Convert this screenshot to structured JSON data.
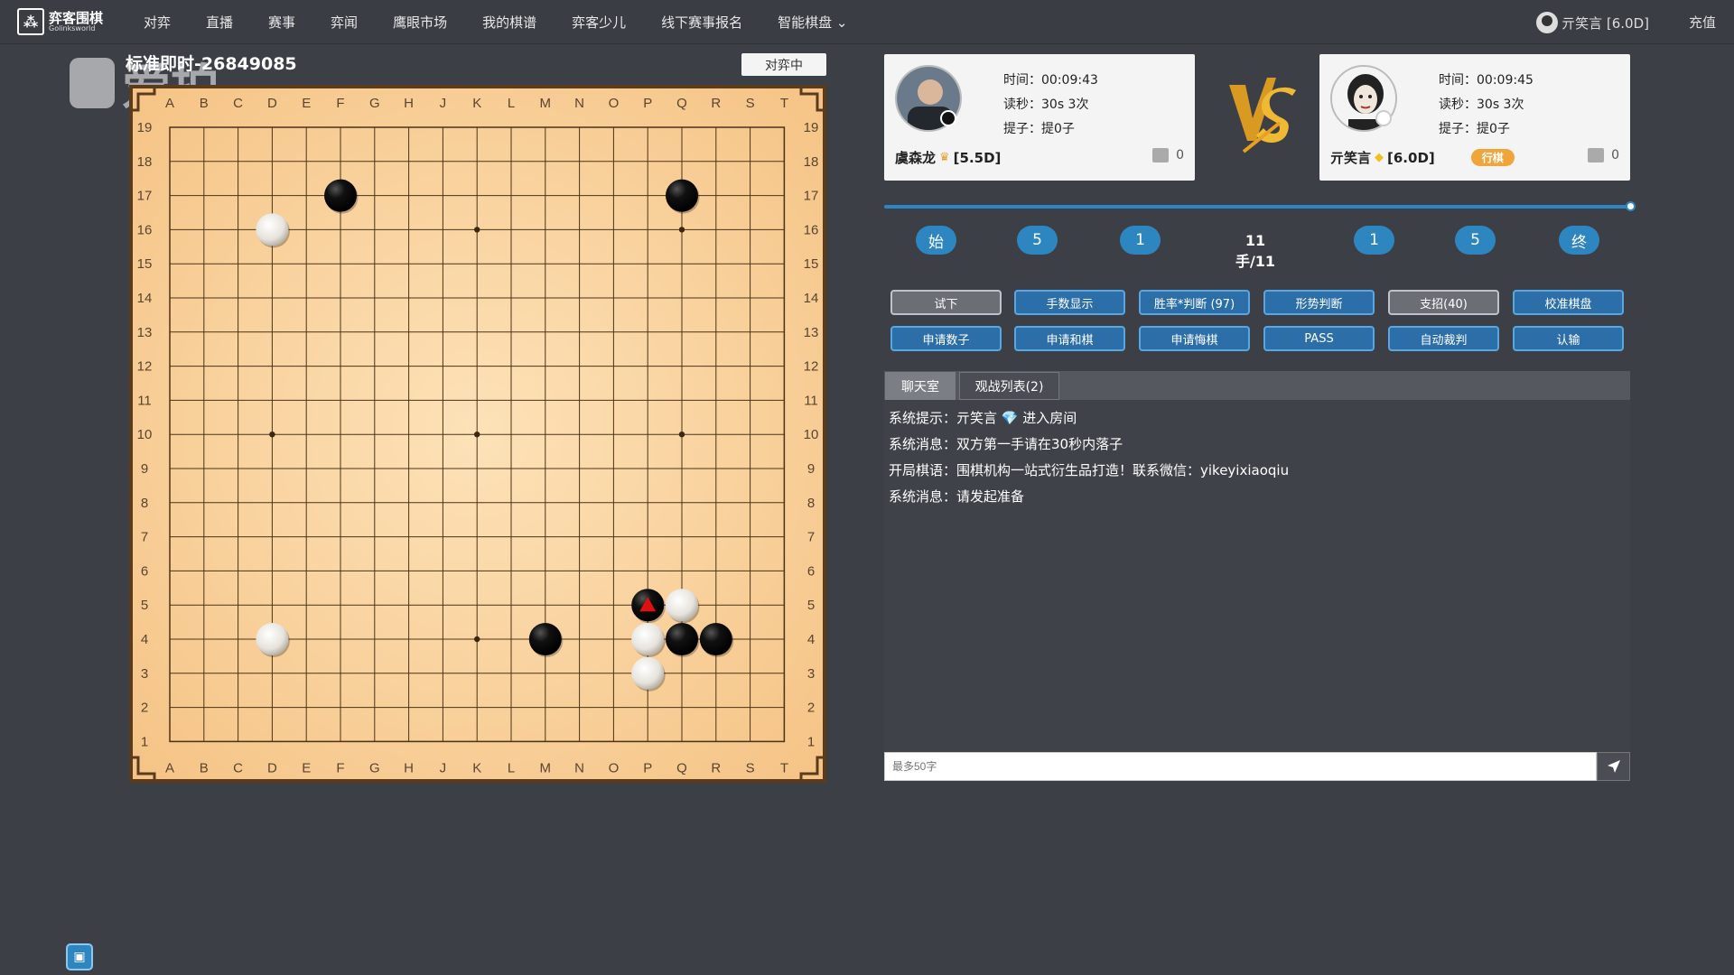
{
  "logo": {
    "cn": "弈客围棋",
    "en": "Golinksworld"
  },
  "nav": [
    "对弈",
    "直播",
    "赛事",
    "弈闻",
    "鹰眼市场",
    "我的棋谱",
    "弈客少儿",
    "线下赛事报名",
    "智能棋盘 ⌄"
  ],
  "user": {
    "name": "亓笑言 [6.0D]",
    "recharge": "充值"
  },
  "watermark": "爱拍",
  "game": {
    "title": "标准即时-26849085",
    "status": "对弈中"
  },
  "board": {
    "col_labels": [
      "A",
      "B",
      "C",
      "D",
      "E",
      "F",
      "G",
      "H",
      "J",
      "K",
      "L",
      "M",
      "N",
      "O",
      "P",
      "Q",
      "R",
      "S",
      "T"
    ],
    "row_labels": [
      "19",
      "18",
      "17",
      "16",
      "15",
      "14",
      "13",
      "12",
      "11",
      "10",
      "9",
      "8",
      "7",
      "6",
      "5",
      "4",
      "3",
      "2",
      "1"
    ],
    "stones": [
      {
        "color": "black",
        "pos": "F17"
      },
      {
        "color": "black",
        "pos": "Q17"
      },
      {
        "color": "white",
        "pos": "D16"
      },
      {
        "color": "white",
        "pos": "D4"
      },
      {
        "color": "black",
        "pos": "M4"
      },
      {
        "color": "black",
        "pos": "P5",
        "last": true
      },
      {
        "color": "white",
        "pos": "Q5"
      },
      {
        "color": "white",
        "pos": "P4"
      },
      {
        "color": "black",
        "pos": "Q4"
      },
      {
        "color": "black",
        "pos": "R4"
      },
      {
        "color": "white",
        "pos": "P3"
      }
    ]
  },
  "player_black": {
    "name": "虞森龙",
    "rank": "[5.5D]",
    "time_label": "时间：",
    "time": "00:09:43",
    "byoyomi_label": "读秒：",
    "byoyomi": "30s 3次",
    "captures_label": "提子：",
    "captures": "提0子",
    "likes": "0"
  },
  "player_white": {
    "name": "亓笑言",
    "rank": "[6.0D]",
    "badge": "行棋",
    "time_label": "时间：",
    "time": "00:09:45",
    "byoyomi_label": "读秒：",
    "byoyomi": "30s 3次",
    "captures_label": "提子：",
    "captures": "提0子",
    "likes": "0"
  },
  "navigation": {
    "start": "始",
    "back5": "5",
    "back1": "1",
    "move": "11手/11",
    "fwd1": "1",
    "fwd5": "5",
    "end": "终",
    "progress": 1.0
  },
  "actions": [
    {
      "label": "试下",
      "style": "gray"
    },
    {
      "label": "手数显示",
      "style": "blue"
    },
    {
      "label": "胜率*判断 (97)",
      "style": "blue"
    },
    {
      "label": "形势判断",
      "style": "blue"
    },
    {
      "label": "支招(40)",
      "style": "gray"
    },
    {
      "label": "校准棋盘",
      "style": "blue"
    },
    {
      "label": "申请数子",
      "style": "blue"
    },
    {
      "label": "申请和棋",
      "style": "blue"
    },
    {
      "label": "申请悔棋",
      "style": "blue"
    },
    {
      "label": "PASS",
      "style": "blue"
    },
    {
      "label": "自动裁判",
      "style": "blue"
    },
    {
      "label": "认输",
      "style": "blue"
    }
  ],
  "chat": {
    "tab_chat": "聊天室",
    "tab_watchers": "观战列表(2)",
    "messages": [
      "系统提示：亓笑言 💎 进入房间",
      "系统消息：双方第一手请在30秒内落子",
      "开局棋语：围棋机构一站式衍生品打造！联系微信：yikeyixiaoqiu",
      "系统消息：请发起准备"
    ],
    "placeholder": "最多50字"
  },
  "icons": {
    "send": "send-icon",
    "thumb": "thumbs-up-icon",
    "crown": "crown-icon",
    "gem": "gem-icon",
    "bottom": "cube-icon"
  },
  "colors": {
    "accent": "#2e86c1",
    "board": "#f6c88a",
    "panel": "#3c3f46"
  }
}
